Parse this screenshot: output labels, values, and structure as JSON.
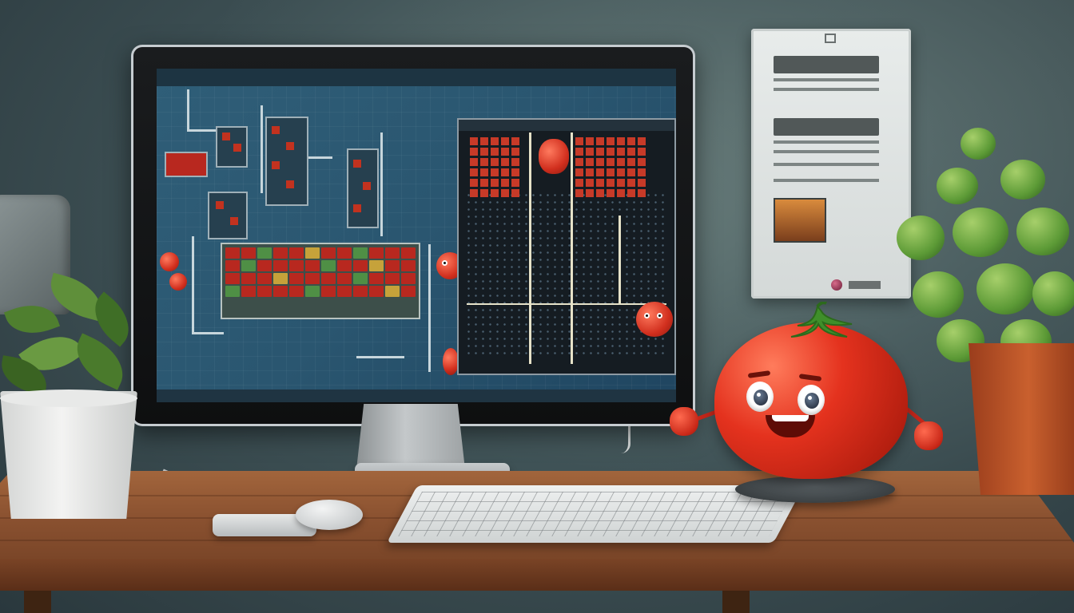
{
  "scene": {
    "description_tags": [
      "wall-panel",
      "monitor",
      "tomato-character",
      "desk",
      "keyboard",
      "mouse",
      "potted-plants"
    ]
  },
  "colors": {
    "wall": "#3f5256",
    "desk_wood": "#8a5130",
    "tomato_red": "#e4321e",
    "screen_blue": "#2f5e78",
    "basil_green": "#5c9a36"
  },
  "icons": {
    "monitor": "monitor-icon",
    "tomato": "tomato-icon",
    "keyboard": "keyboard-icon",
    "mouse": "mouse-icon",
    "plant": "plant-icon"
  }
}
